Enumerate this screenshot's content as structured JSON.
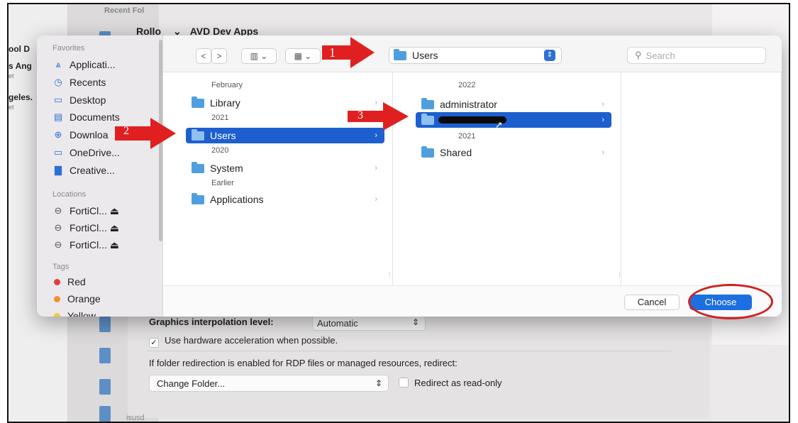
{
  "background": {
    "recent_folders_label": "Recent Fol",
    "left_texts": [
      {
        "bold": "",
        "sub": ""
      },
      {
        "bold": "ool D",
        "sub": ""
      },
      {
        "bold": "s Ang",
        "sub": "et"
      },
      {
        "bold": "geles.",
        "sub": "et"
      }
    ],
    "rollo_label": "Rollo",
    "avd_label": "AVD Dev Apps",
    "graphics_label": "Graphics interpolation level:",
    "graphics_value": "Automatic",
    "hw_accel_label": "Use hardware acceleration when possible.",
    "redirect_label": "If folder redirection is enabled for RDP files or managed resources, redirect:",
    "change_folder_value": "Change Folder...",
    "read_only_label": "Redirect as read-only",
    "isusd_label": "isusd"
  },
  "sidebar": {
    "favorites_header": "Favorites",
    "favorites": [
      {
        "label": "Applicati...",
        "icon": "applications-icon",
        "glyph": "⩓"
      },
      {
        "label": "Recents",
        "icon": "recents-icon",
        "glyph": "◷"
      },
      {
        "label": "Desktop",
        "icon": "desktop-icon",
        "glyph": "▭"
      },
      {
        "label": "Documents",
        "icon": "documents-icon",
        "glyph": "▤"
      },
      {
        "label": "Downloa",
        "icon": "downloads-icon",
        "glyph": "⊕"
      },
      {
        "label": "OneDrive...",
        "icon": "onedrive-folder-icon",
        "glyph": "▭"
      },
      {
        "label": "Creative...",
        "icon": "creative-cloud-icon",
        "glyph": "▇"
      }
    ],
    "locations_header": "Locations",
    "locations": [
      {
        "label": "FortiCl... ⏏",
        "icon": "drive-icon"
      },
      {
        "label": "FortiCl... ⏏",
        "icon": "drive-icon"
      },
      {
        "label": "FortiCl... ⏏",
        "icon": "drive-icon"
      }
    ],
    "tags_header": "Tags",
    "tags": [
      {
        "label": "Red",
        "color": "#e0403a"
      },
      {
        "label": "Orange",
        "color": "#f0932b"
      },
      {
        "label": "Yellow",
        "color": "#f2c744"
      }
    ]
  },
  "toolbar": {
    "back": "<",
    "forward": ">",
    "view_columns": "▥ ⌄",
    "view_grid": "▦ ⌄",
    "path_value": "Users",
    "search_placeholder": "Search"
  },
  "column1": {
    "groups": [
      {
        "header": "February",
        "items": [
          {
            "label": "Library",
            "selected": false
          }
        ]
      },
      {
        "header": "2021",
        "items": [
          {
            "label": "Users",
            "selected": true
          }
        ]
      },
      {
        "header": "2020",
        "items": [
          {
            "label": "System",
            "selected": false
          }
        ]
      },
      {
        "header": "Earlier",
        "items": [
          {
            "label": "Applications",
            "selected": false
          }
        ]
      }
    ]
  },
  "column2": {
    "header_2022": "2022",
    "item_admin": "administrator",
    "header_2021": "2021",
    "item_shared": "Shared"
  },
  "footer": {
    "cancel_label": "Cancel",
    "choose_label": "Choose"
  },
  "annotations": {
    "arrow1_number": "1",
    "arrow2_number": "2",
    "arrow3_number": "3",
    "arrow_color": "#e02020",
    "circle_color": "#d02020"
  }
}
